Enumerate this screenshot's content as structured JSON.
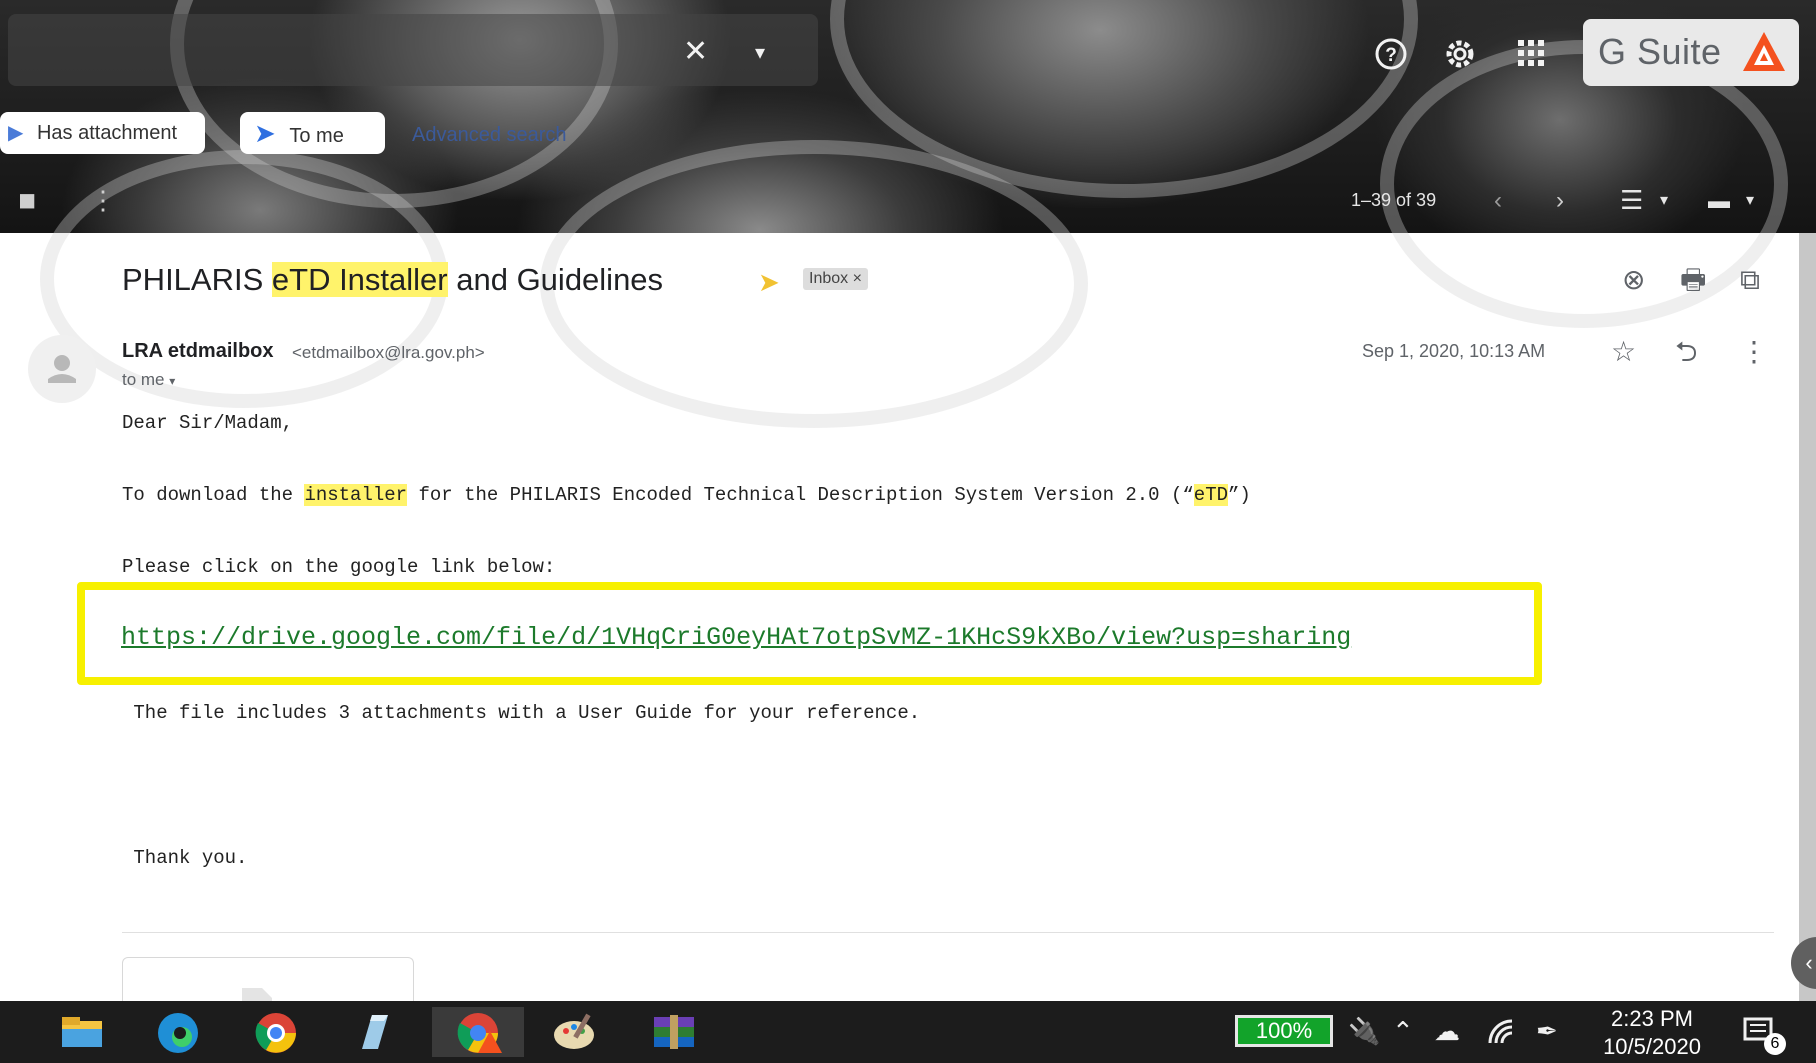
{
  "header": {
    "search_clear_icon": "close-icon",
    "search_options_icon": "caret-down-icon",
    "support_icon": "help-circle-icon",
    "settings_icon": "gear-icon",
    "apps_icon": "apps-grid-icon",
    "brand": "G Suite",
    "chips": {
      "has_attachment": "Has attachment",
      "to_me": "To me"
    },
    "advanced_search": "Advanced search",
    "pager": "1–39 of 39"
  },
  "email": {
    "subject_parts": [
      "PHILARIS ",
      "eTD Installer",
      " and Guidelines"
    ],
    "label": "Inbox",
    "label_close": "×",
    "sender_name": "LRA etdmailbox",
    "sender_email": "<etdmailbox@lra.gov.ph>",
    "recipient": "to me",
    "date": "Sep 1, 2020, 10:13 AM",
    "body": {
      "greeting": "Dear Sir/Madam,",
      "line1_parts": [
        "To download the ",
        "installer",
        " for the PHILARIS Encoded Technical Description System Version 2.0 (“",
        "eTD",
        "”)"
      ],
      "line2": "Please click on the google link below:",
      "link": "https://drive.google.com/file/d/1VHqCriG0eyHAt7otpSvMZ-1KHcS9kXBo/view?usp=sharing",
      "line3": " The file includes 3 attachments with a User Guide for your reference.",
      "closing": " Thank you."
    }
  },
  "taskbar": {
    "battery": "100%",
    "time": "2:23 PM",
    "date": "10/5/2020",
    "notifications": "6"
  },
  "colors": {
    "highlight": "#fff36b",
    "link_box": "#f7f000",
    "link": "#1c7a2b",
    "battery": "#12a32a"
  }
}
